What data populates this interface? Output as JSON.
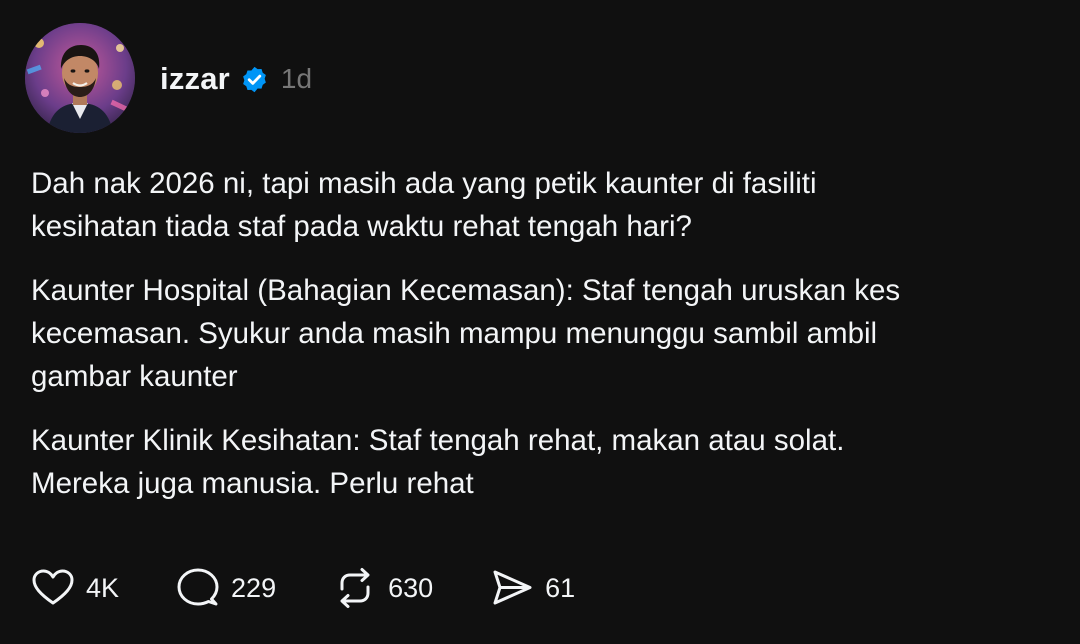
{
  "post": {
    "author": {
      "username": "izzar",
      "verified": true,
      "avatar_icon": "profile-photo"
    },
    "timestamp": "1d",
    "paragraphs": [
      "Dah nak 2026 ni, tapi masih ada yang petik kaunter di fasiliti\nkesihatan tiada staf pada waktu rehat tengah hari?",
      "Kaunter Hospital (Bahagian Kecemasan): Staf tengah uruskan kes\nkecemasan. Syukur anda masih mampu menunggu sambil ambil\ngambar kaunter",
      "Kaunter Klinik Kesihatan: Staf tengah rehat, makan atau solat.\nMereka juga manusia. Perlu rehat"
    ],
    "actions": {
      "like": {
        "icon": "heart-icon",
        "count": "4K"
      },
      "reply": {
        "icon": "comment-icon",
        "count": "229"
      },
      "repost": {
        "icon": "repost-icon",
        "count": "630"
      },
      "share": {
        "icon": "send-icon",
        "count": "61"
      }
    }
  },
  "colors": {
    "background": "#101010",
    "text": "#f3f5f7",
    "muted": "#777777",
    "verified_badge": "#0095f6"
  }
}
